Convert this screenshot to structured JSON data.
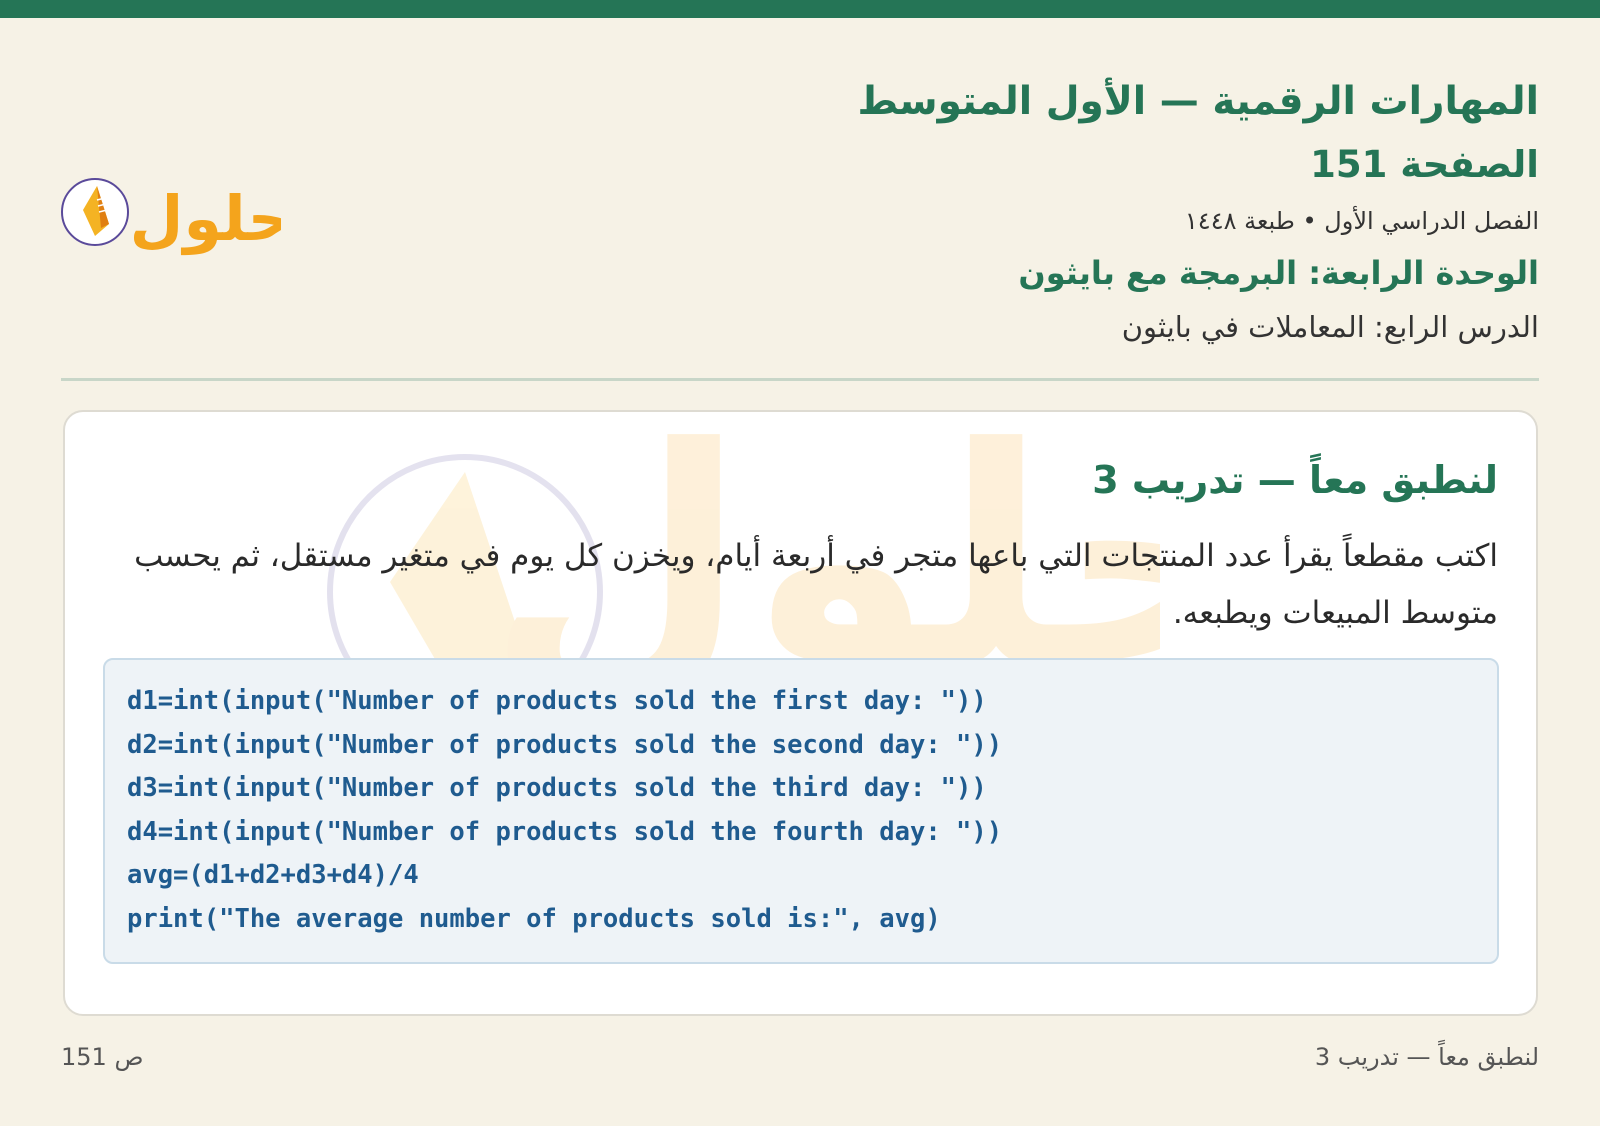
{
  "header": {
    "title": "المهارات الرقمية — الأول المتوسط",
    "page": "الصفحة 151",
    "meta": "الفصل الدراسي الأول • طبعة ١٤٤٨",
    "unit": "الوحدة الرابعة: البرمجة مع بايثون",
    "lesson": "الدرس الرابع: المعاملات في بايثون"
  },
  "logo": {
    "text": "حلول"
  },
  "card": {
    "title": "لنطبق معاً — تدريب 3",
    "prompt": "اكتب مقطعاً يقرأ عدد المنتجات التي باعها متجر في أربعة أيام، ويخزن كل يوم في متغير مستقل، ثم يحسب متوسط المبيعات ويطبعه.",
    "code_lines": [
      "d1=int(input(\"Number of products sold the first day: \"))",
      "d2=int(input(\"Number of products sold the second day: \"))",
      "d3=int(input(\"Number of products sold the third day: \"))",
      "d4=int(input(\"Number of products sold the fourth day: \"))",
      "avg=(d1+d2+d3+d4)/4",
      "print(\"The average number of products sold is:\", avg)"
    ]
  },
  "footer": {
    "section": "لنطبق معاً — تدريب 3",
    "page_label": "ص 151"
  },
  "colors": {
    "accent": "#257556",
    "background": "#f6f2e6",
    "code_text": "#1f5b8f",
    "logo_orange": "#f4a41c"
  }
}
